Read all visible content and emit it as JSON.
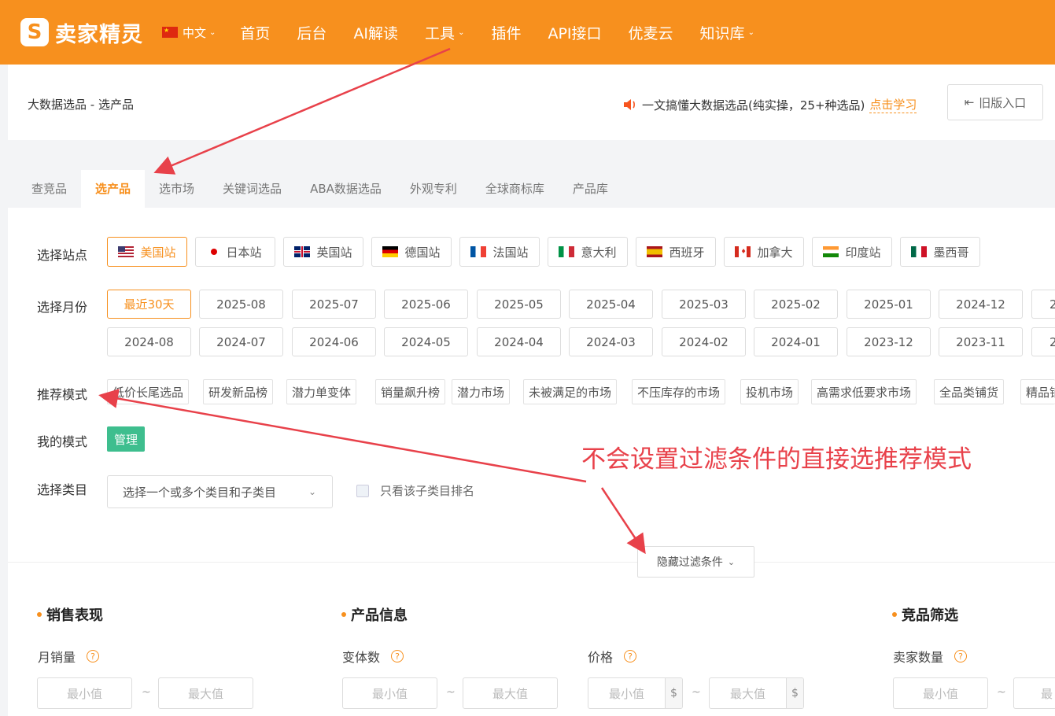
{
  "nav": {
    "logo_text": "卖家精灵",
    "lang": "中文",
    "items": [
      "首页",
      "后台",
      "AI解读",
      "工具",
      "插件",
      "API接口",
      "优麦云",
      "知识库"
    ]
  },
  "header": {
    "breadcrumb": "大数据选品 - 选产品",
    "notice": "一文搞懂大数据选品(纯实操，25+种选品)",
    "learn_link": "点击学习",
    "old_entry": "旧版入口"
  },
  "tabs": [
    "查竞品",
    "选产品",
    "选市场",
    "关键词选品",
    "ABA数据选品",
    "外观专利",
    "全球商标库",
    "产品库"
  ],
  "filters": {
    "site_label": "选择站点",
    "sites": [
      "美国站",
      "日本站",
      "英国站",
      "德国站",
      "法国站",
      "意大利",
      "西班牙",
      "加拿大",
      "印度站",
      "墨西哥"
    ],
    "month_label": "选择月份",
    "months_row1": [
      "最近30天",
      "2025-08",
      "2025-07",
      "2025-06",
      "2025-05",
      "2025-04",
      "2025-03",
      "2025-02",
      "2025-01",
      "2024-12",
      "2"
    ],
    "months_row2": [
      "2024-08",
      "2024-07",
      "2024-06",
      "2024-05",
      "2024-04",
      "2024-03",
      "2024-02",
      "2024-01",
      "2023-12",
      "2023-11",
      "2"
    ],
    "mode_label": "推荐模式",
    "modes": [
      "低价长尾选品",
      "研发新品榜",
      "潜力单变体",
      "销量飙升榜",
      "潜力市场",
      "未被满足的市场",
      "不压库存的市场",
      "投机市场",
      "高需求低要求市场",
      "全品类铺货",
      "精品铺"
    ],
    "my_mode_label": "我的模式",
    "manage": "管理",
    "category_label": "选择类目",
    "category_placeholder": "选择一个或多个类目和子类目",
    "subcat_only": "只看该子类目排名",
    "hide_filters": "隐藏过滤条件"
  },
  "sections": {
    "sales": "销售表现",
    "product": "产品信息",
    "competitor": "竞品筛选",
    "monthly_sales": "月销量",
    "variants": "变体数",
    "price": "价格",
    "seller_count": "卖家数量",
    "min": "最小值",
    "max": "最大值",
    "max_short": "最",
    "currency": "$",
    "tilde": "~"
  },
  "annotation": "不会设置过滤条件的直接选推荐模式",
  "colors": {
    "brand": "#f7901e",
    "annotation": "#e8414a",
    "manage": "#3ebe8e"
  }
}
